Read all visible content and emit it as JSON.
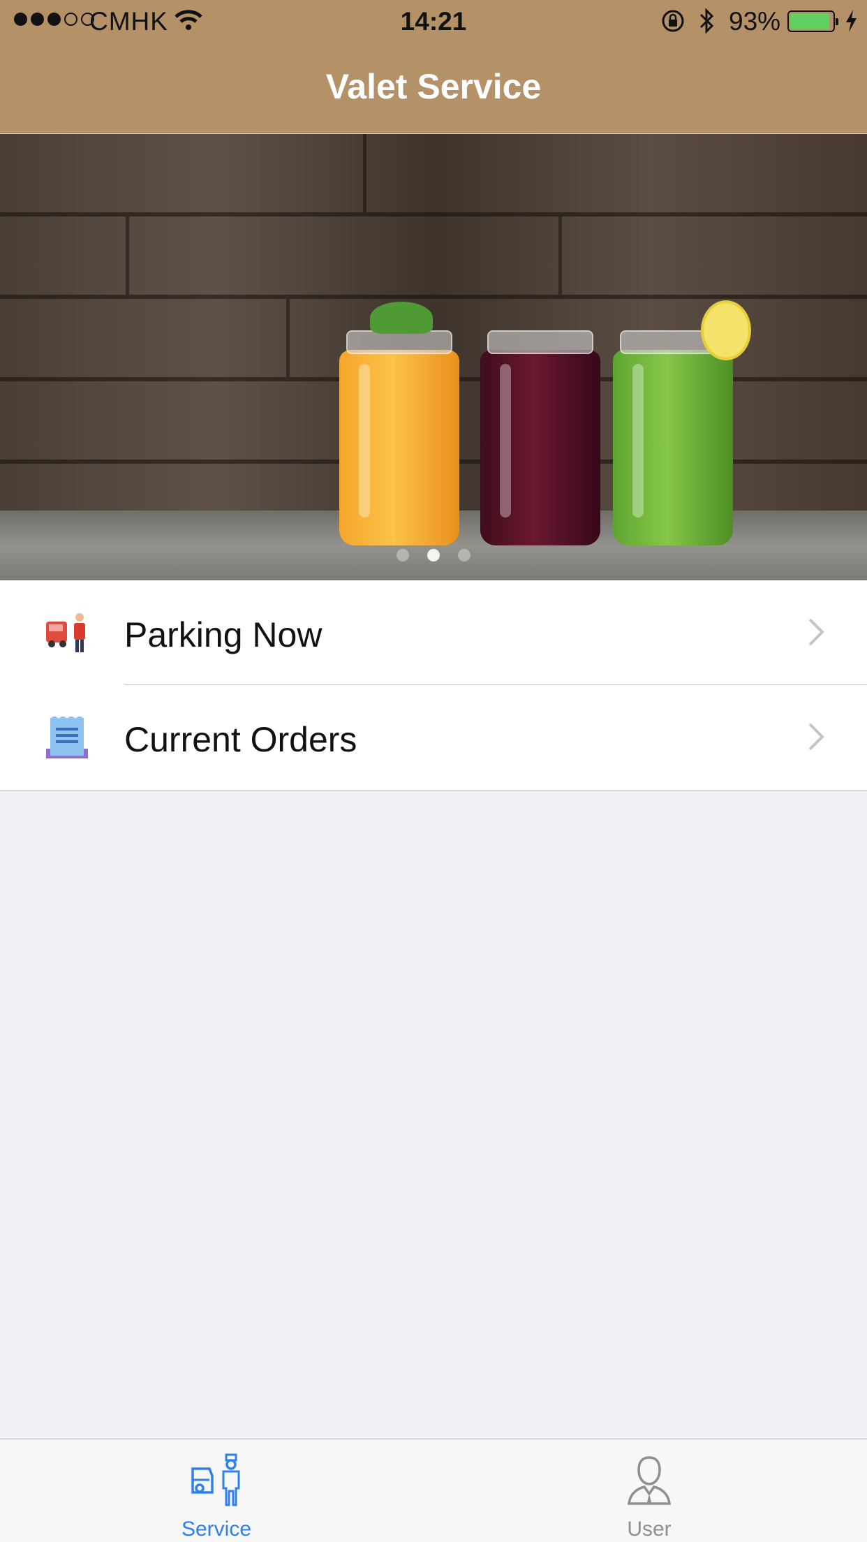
{
  "status_bar": {
    "carrier": "CMHK",
    "time": "14:21",
    "battery_percent": "93%",
    "signal_bars": 3,
    "signal_total": 5,
    "battery_level": 0.93,
    "battery_color": "#5fd05f",
    "icons": [
      "wifi-icon",
      "rotation-lock-icon",
      "bluetooth-icon",
      "battery-icon",
      "charging-bolt-icon"
    ]
  },
  "nav": {
    "title": "Valet Service",
    "background": "#b59168"
  },
  "banner": {
    "page_count": 3,
    "active_page": 2
  },
  "menu": {
    "items": [
      {
        "label": "Parking Now",
        "icon": "valet-parking-icon"
      },
      {
        "label": "Current Orders",
        "icon": "orders-receipt-icon"
      }
    ]
  },
  "tabbar": {
    "active_color": "#2f80ed",
    "inactive_color": "#8e8e93",
    "tabs": [
      {
        "label": "Service",
        "icon": "valet-service-icon",
        "active": true
      },
      {
        "label": "User",
        "icon": "user-icon",
        "active": false
      }
    ]
  }
}
